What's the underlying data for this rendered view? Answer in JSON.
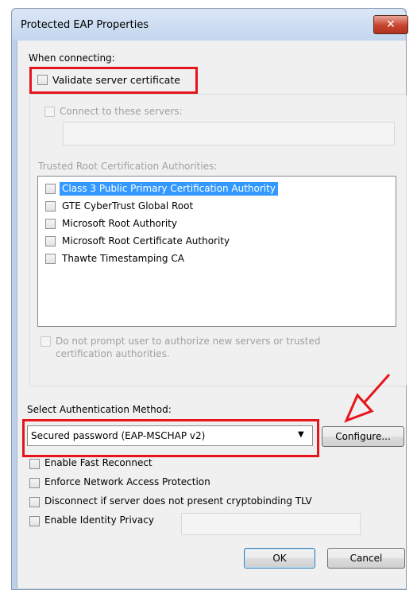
{
  "window": {
    "title": "Protected EAP Properties",
    "close_glyph": "✕"
  },
  "when_connecting": "When connecting:",
  "validate_server_certificate": {
    "label": "Validate server certificate",
    "checked": false
  },
  "connect_to_servers": {
    "label": "Connect to these servers:",
    "checked": false,
    "value": ""
  },
  "trusted_roots": {
    "label": "Trusted Root Certification Authorities:",
    "items": [
      {
        "label": "Class 3 Public Primary Certification Authority",
        "checked": false,
        "selected": true
      },
      {
        "label": "GTE CyberTrust Global Root",
        "checked": false,
        "selected": false
      },
      {
        "label": "Microsoft Root Authority",
        "checked": false,
        "selected": false
      },
      {
        "label": "Microsoft Root Certificate Authority",
        "checked": false,
        "selected": false
      },
      {
        "label": "Thawte Timestamping CA",
        "checked": false,
        "selected": false
      }
    ]
  },
  "do_not_prompt": {
    "line1": "Do not prompt user to authorize new servers or trusted",
    "line2": "certification authorities.",
    "checked": false
  },
  "auth_method": {
    "label": "Select Authentication Method:",
    "selected": "Secured password (EAP-MSCHAP v2)",
    "configure_label": "Configure..."
  },
  "options": [
    {
      "label": "Enable Fast Reconnect",
      "checked": false
    },
    {
      "label": "Enforce Network Access Protection",
      "checked": false
    },
    {
      "label": "Disconnect if server does not present cryptobinding TLV",
      "checked": false
    },
    {
      "label": "Enable Identity Privacy",
      "checked": false
    }
  ],
  "identity_privacy_value": "",
  "buttons": {
    "ok": "OK",
    "cancel": "Cancel"
  },
  "colors": {
    "annotation_red": "#e8141b",
    "selection_blue": "#3399ff"
  }
}
